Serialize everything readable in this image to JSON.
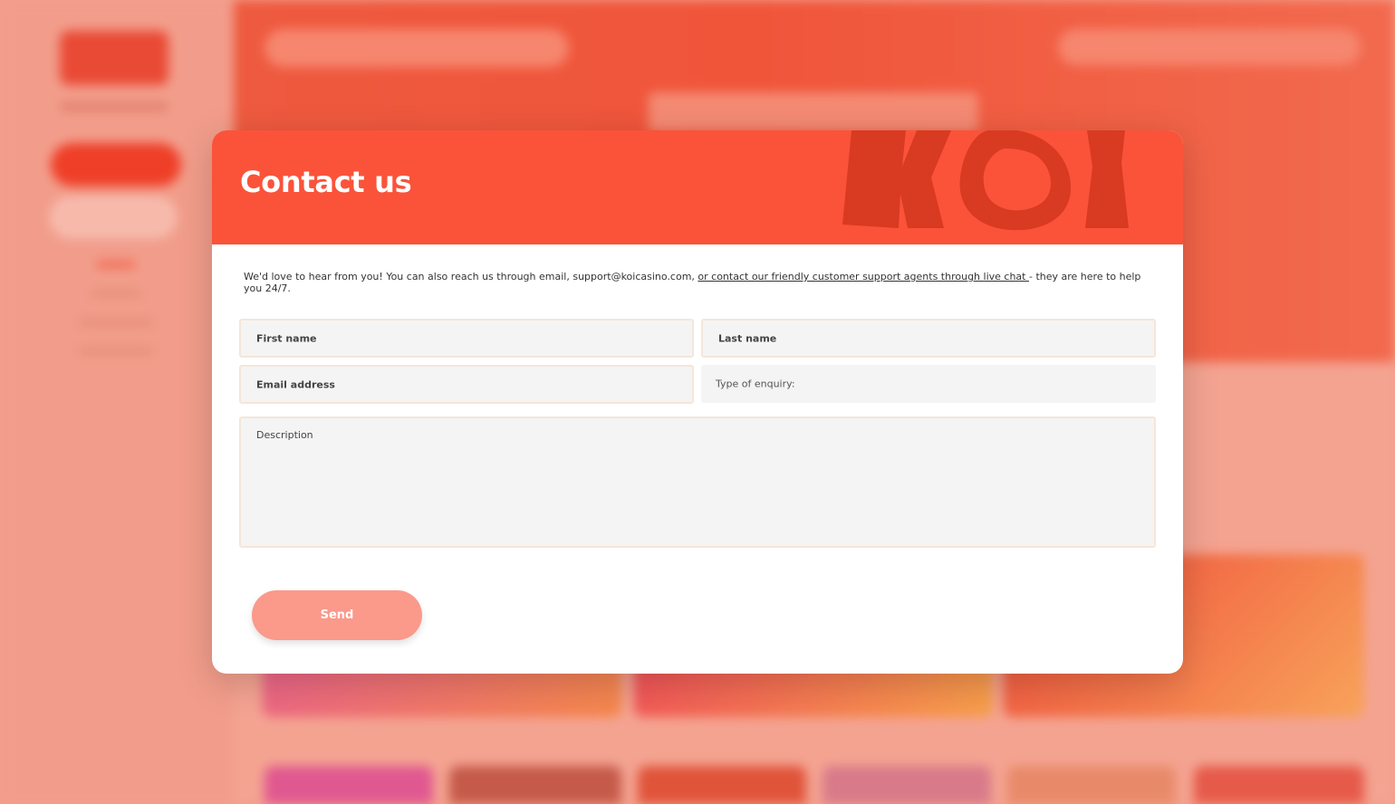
{
  "colors": {
    "modal_header": "#fa533a",
    "logo_shape": "#d93a22",
    "send_button": "#fb998b",
    "field_background": "#f4f4f4",
    "field_border": "#f4e6da",
    "page_backdrop": "#f3a08c"
  },
  "modal": {
    "title": "Contact us",
    "intro": {
      "prefix": "We'd love to hear from you! You can also reach us through email, support@koicasino.com, ",
      "link": "or contact our friendly customer support agents through live chat ",
      "suffix": "- they are here to help you 24/7."
    },
    "form": {
      "first_name": "First name",
      "last_name": "Last name",
      "email": "Email address",
      "enquiry": "Type of enquiry:",
      "description": "Description"
    },
    "send_label": "Send"
  }
}
